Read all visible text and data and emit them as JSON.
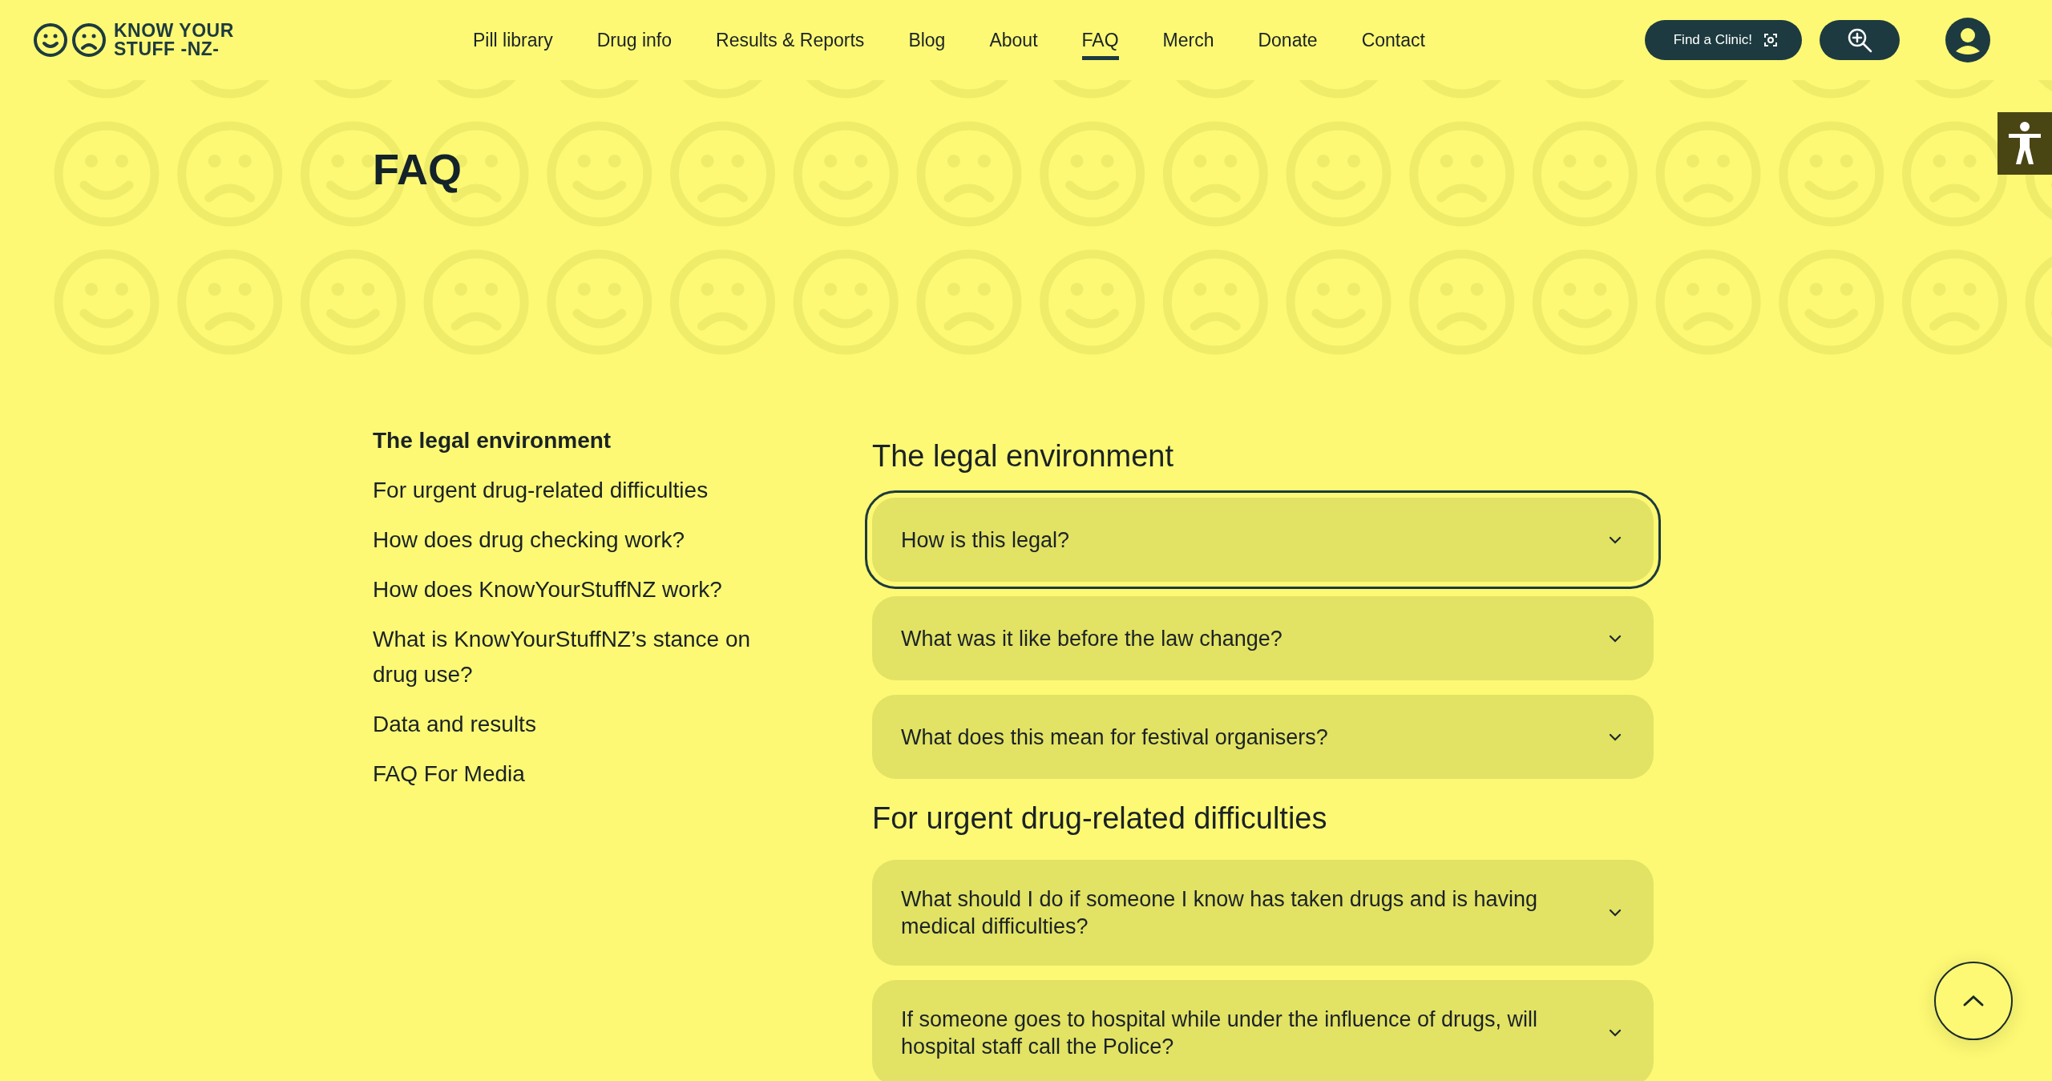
{
  "header": {
    "logo": {
      "line_1": "KNOW YOUR",
      "line_2": "STUFF -NZ-"
    },
    "nav": [
      {
        "label": "Pill library",
        "selected": false
      },
      {
        "label": "Drug info",
        "selected": false
      },
      {
        "label": "Results & Reports",
        "selected": false
      },
      {
        "label": "Blog",
        "selected": false
      },
      {
        "label": "About",
        "selected": false
      },
      {
        "label": "FAQ",
        "selected": true
      },
      {
        "label": "Merch",
        "selected": false
      },
      {
        "label": "Donate",
        "selected": false
      },
      {
        "label": "Contact",
        "selected": false
      }
    ],
    "find_clinic": {
      "label": "Find a Clinic!"
    }
  },
  "page_title": "FAQ",
  "sidebar": {
    "items": [
      {
        "label": "The legal environment",
        "selected": true
      },
      {
        "label": "For urgent drug-related difficulties",
        "selected": false
      },
      {
        "label": "How does drug checking work?",
        "selected": false
      },
      {
        "label": "How does KnowYourStuffNZ work?",
        "selected": false
      },
      {
        "label": "What is KnowYourStuffNZ’s stance on drug use?",
        "selected": false
      },
      {
        "label": "Data and results",
        "selected": false
      },
      {
        "label": "FAQ For Media",
        "selected": false
      }
    ]
  },
  "sections": [
    {
      "heading": "The legal environment",
      "questions": [
        {
          "text": "How is this legal?",
          "focused": true,
          "expanded": false
        },
        {
          "text": "What was it like before the law change?",
          "focused": false,
          "expanded": false
        },
        {
          "text": "What does this mean for festival organisers?",
          "focused": false,
          "expanded": false
        }
      ]
    },
    {
      "heading": "For urgent drug-related difficulties",
      "questions": [
        {
          "text": "What should I do if someone I know has taken drugs and is having medical difficulties?",
          "focused": false,
          "expanded": false
        },
        {
          "text": "If someone goes to hospital while under the influence of drugs, will hospital staff call the Police?",
          "focused": false,
          "expanded": false
        }
      ]
    }
  ]
}
